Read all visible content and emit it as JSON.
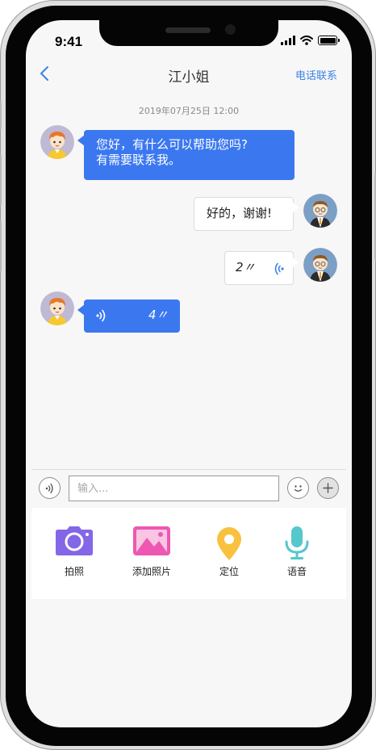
{
  "status_bar": {
    "time": "9:41"
  },
  "header": {
    "back_icon": "chevron-left-icon",
    "title": "江小姐",
    "call_label": "电话联系"
  },
  "conversation": {
    "timestamp": "2019年07月25日 12:00",
    "messages": [
      {
        "sender": "contact",
        "type": "text",
        "lines": [
          "您好，有什么可以帮助您吗?",
          "有需要联系我。"
        ]
      },
      {
        "sender": "me",
        "type": "text",
        "text": "好的，谢谢!"
      },
      {
        "sender": "me",
        "type": "voice",
        "duration": "2〃"
      },
      {
        "sender": "contact",
        "type": "voice",
        "duration": "4〃"
      }
    ]
  },
  "composer": {
    "voice_button_icon": "voice-wave-icon",
    "input_value": "",
    "input_placeholder": "输入...",
    "emoji_button_icon": "smiley-icon",
    "plus_button_icon": "plus-icon"
  },
  "tools": [
    {
      "icon": "camera-icon",
      "label": "拍照"
    },
    {
      "icon": "image-icon",
      "label": "添加照片"
    },
    {
      "icon": "location-pin-icon",
      "label": "定位"
    },
    {
      "icon": "microphone-icon",
      "label": "语音"
    }
  ],
  "colors": {
    "accent": "#3a82e6",
    "incoming_bubble": "#3b78f0",
    "camera_icon": "#8367e6",
    "image_icon": "#ee58b2",
    "location_icon": "#f8c23e",
    "mic_icon": "#54c8cc"
  }
}
